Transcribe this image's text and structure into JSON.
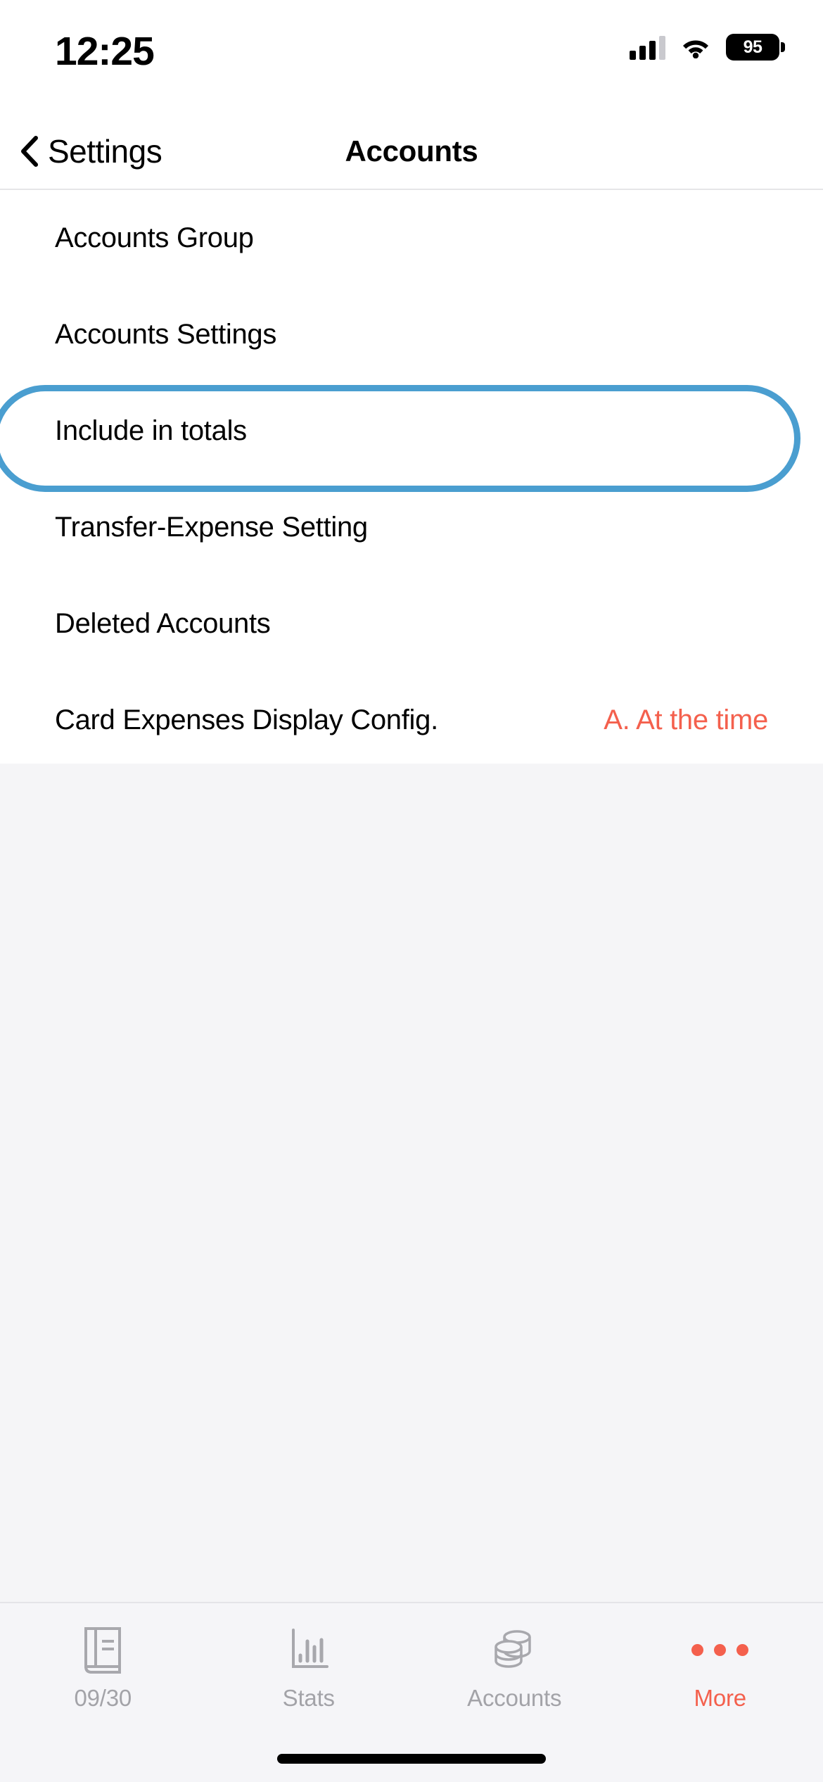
{
  "status_bar": {
    "time": "12:25",
    "signal_icon": "cellular-signal-icon",
    "signal_bars_filled": 3,
    "signal_bars_total": 4,
    "wifi_icon": "wifi-icon",
    "battery_percent": "95",
    "battery_icon": "battery-icon"
  },
  "nav": {
    "back_icon": "chevron-left-icon",
    "back_label": "Settings",
    "title": "Accounts"
  },
  "list": {
    "rows": [
      {
        "label": "Accounts Group",
        "value": ""
      },
      {
        "label": "Accounts Settings",
        "value": ""
      },
      {
        "label": "Include in totals",
        "value": ""
      },
      {
        "label": "Transfer-Expense Setting",
        "value": ""
      },
      {
        "label": "Deleted Accounts",
        "value": ""
      },
      {
        "label": "Card Expenses Display Config.",
        "value": "A. At the time"
      }
    ]
  },
  "highlight": {
    "target_row_label": "Include in totals",
    "color": "#4a9ed0"
  },
  "tabbar": {
    "tabs": [
      {
        "label": "09/30",
        "icon": "ledger-book-icon",
        "active": false
      },
      {
        "label": "Stats",
        "icon": "bar-chart-icon",
        "active": false
      },
      {
        "label": "Accounts",
        "icon": "coins-stack-icon",
        "active": false
      },
      {
        "label": "More",
        "icon": "ellipsis-icon",
        "active": true
      }
    ]
  },
  "colors": {
    "accent_red": "#f4604d",
    "highlight_blue": "#4a9ed0",
    "inactive_gray": "#a3a3a8",
    "page_bg": "#f5f5f7",
    "card_bg": "#ffffff"
  },
  "home_indicator": "home-indicator"
}
